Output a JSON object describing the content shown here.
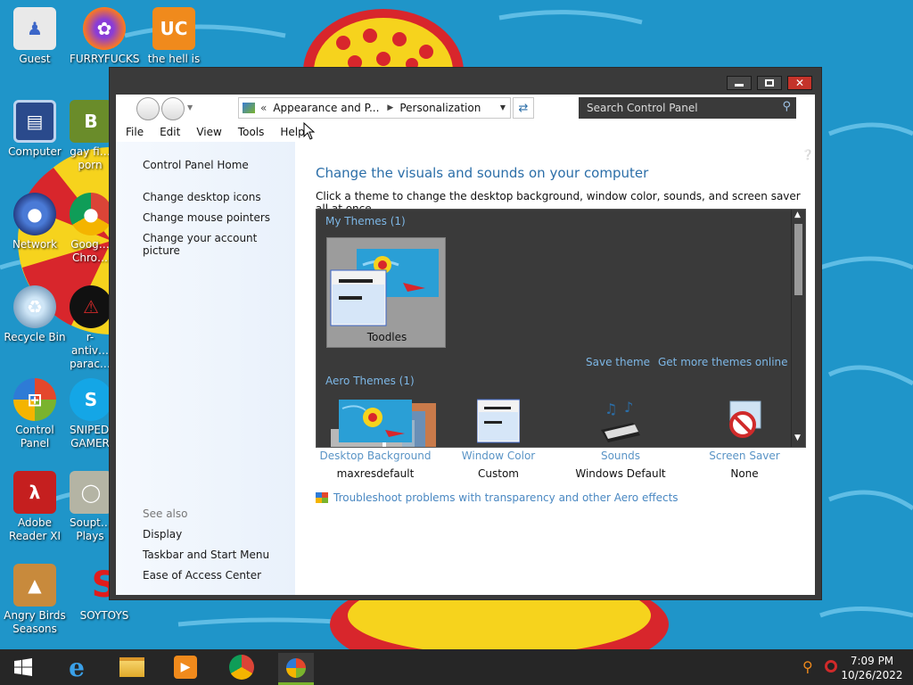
{
  "desktop": {
    "icons": [
      {
        "label": "Guest"
      },
      {
        "label": "FURRYFUCKS"
      },
      {
        "label": "the hell is"
      },
      {
        "label": "Computer"
      },
      {
        "label": "gay fi… porn"
      },
      {
        "label": "Network"
      },
      {
        "label": "Goog… Chro…"
      },
      {
        "label": "Recycle Bin"
      },
      {
        "label": "r-antiv… parac…"
      },
      {
        "label": "Control Panel"
      },
      {
        "label": "SNIPED! GAMER"
      },
      {
        "label": "Adobe Reader XI"
      },
      {
        "label": "Soupt… Plays"
      },
      {
        "label": "Angry Birds Seasons"
      },
      {
        "label": "SOYTOYS"
      }
    ]
  },
  "window": {
    "address": {
      "prefix": "«",
      "crumb1": "Appearance and P...",
      "crumb2": "Personalization"
    },
    "search_placeholder": "Search Control Panel",
    "menu": [
      "File",
      "Edit",
      "View",
      "Tools",
      "Help"
    ],
    "left_pane": {
      "home": "Control Panel Home",
      "links": [
        "Change desktop icons",
        "Change mouse pointers",
        "Change your account picture"
      ],
      "see_also_title": "See also",
      "see_also": [
        "Display",
        "Taskbar and Start Menu",
        "Ease of Access Center"
      ]
    },
    "main": {
      "heading": "Change the visuals and sounds on your computer",
      "subtext": "Click a theme to change the desktop background, window color, sounds, and screen saver all at once.",
      "my_themes_header": "My Themes (1)",
      "selected_theme": "Toodles",
      "save_theme": "Save theme",
      "get_more": "Get more themes online",
      "aero_header": "Aero Themes (1)",
      "options": [
        {
          "label": "Desktop Background",
          "value": "maxresdefault"
        },
        {
          "label": "Window Color",
          "value": "Custom"
        },
        {
          "label": "Sounds",
          "value": "Windows Default"
        },
        {
          "label": "Screen Saver",
          "value": "None"
        }
      ],
      "troubleshoot": "Troubleshoot problems with transparency and other Aero effects"
    }
  },
  "taskbar": {
    "time": "7:09 PM",
    "date": "10/26/2022"
  },
  "colors": {
    "accent_link": "#2b6ea8",
    "window_frame": "#3a3a3a",
    "close_button": "#c4332a"
  }
}
